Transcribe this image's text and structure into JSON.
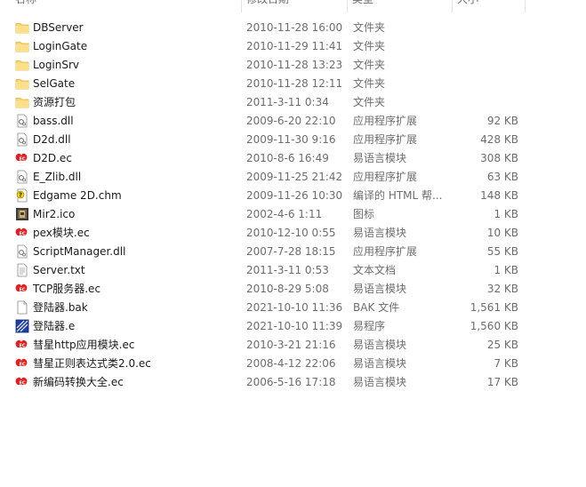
{
  "header": {
    "name": "名称",
    "date": "修改日期",
    "type": "类型",
    "size": "大小"
  },
  "files": [
    {
      "name": "DBServer",
      "date": "2010-11-28 16:00",
      "type": "文件夹",
      "size": "",
      "icon": "folder-icon"
    },
    {
      "name": "LoginGate",
      "date": "2010-11-29 11:41",
      "type": "文件夹",
      "size": "",
      "icon": "folder-icon"
    },
    {
      "name": "LoginSrv",
      "date": "2010-11-28 13:23",
      "type": "文件夹",
      "size": "",
      "icon": "folder-icon"
    },
    {
      "name": "SelGate",
      "date": "2010-11-28 12:11",
      "type": "文件夹",
      "size": "",
      "icon": "folder-icon"
    },
    {
      "name": "资源打包",
      "date": "2011-3-11 0:34",
      "type": "文件夹",
      "size": "",
      "icon": "folder-icon"
    },
    {
      "name": "bass.dll",
      "date": "2009-6-20 22:10",
      "type": "应用程序扩展",
      "size": "92 KB",
      "icon": "dll-icon"
    },
    {
      "name": "D2d.dll",
      "date": "2009-11-30 9:16",
      "type": "应用程序扩展",
      "size": "428 KB",
      "icon": "dll-icon"
    },
    {
      "name": "D2D.ec",
      "date": "2010-8-6 16:49",
      "type": "易语言模块",
      "size": "308 KB",
      "icon": "ec-module-icon"
    },
    {
      "name": "E_Zlib.dll",
      "date": "2009-11-25 21:42",
      "type": "应用程序扩展",
      "size": "63 KB",
      "icon": "dll-icon"
    },
    {
      "name": "Edgame 2D.chm",
      "date": "2009-11-26 10:30",
      "type": "编译的 HTML 帮...",
      "size": "148 KB",
      "icon": "chm-help-icon"
    },
    {
      "name": "Mir2.ico",
      "date": "2002-4-6 1:11",
      "type": "图标",
      "size": "1 KB",
      "icon": "ico-image-icon"
    },
    {
      "name": "pex模块.ec",
      "date": "2010-12-10 0:55",
      "type": "易语言模块",
      "size": "10 KB",
      "icon": "ec-module-icon"
    },
    {
      "name": "ScriptManager.dll",
      "date": "2007-7-28 18:15",
      "type": "应用程序扩展",
      "size": "55 KB",
      "icon": "dll-icon"
    },
    {
      "name": "Server.txt",
      "date": "2011-3-11 0:53",
      "type": "文本文档",
      "size": "1 KB",
      "icon": "text-file-icon"
    },
    {
      "name": "TCP服务器.ec",
      "date": "2010-8-29 5:08",
      "type": "易语言模块",
      "size": "32 KB",
      "icon": "ec-module-icon"
    },
    {
      "name": "登陆器.bak",
      "date": "2021-10-10 11:36",
      "type": "BAK 文件",
      "size": "1,561 KB",
      "icon": "blank-file-icon"
    },
    {
      "name": "登陆器.e",
      "date": "2021-10-10 11:39",
      "type": "易程序",
      "size": "1,560 KB",
      "icon": "e-program-icon"
    },
    {
      "name": "彗星http应用模块.ec",
      "date": "2010-3-21 21:16",
      "type": "易语言模块",
      "size": "25 KB",
      "icon": "ec-module-icon"
    },
    {
      "name": "彗星正则表达式类2.0.ec",
      "date": "2008-4-12 22:06",
      "type": "易语言模块",
      "size": "7 KB",
      "icon": "ec-module-icon"
    },
    {
      "name": "新编码转换大全.ec",
      "date": "2006-5-16 17:18",
      "type": "易语言模块",
      "size": "17 KB",
      "icon": "ec-module-icon"
    }
  ]
}
